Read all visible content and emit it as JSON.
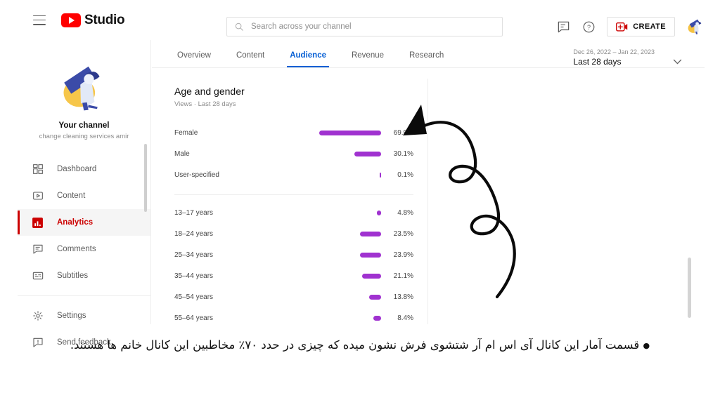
{
  "header": {
    "menu_icon": "hamburger-icon",
    "brand": "Studio",
    "logo_icon": "youtube-play-icon",
    "search": {
      "placeholder": "Search across your channel",
      "value": "",
      "icon": "search-icon"
    },
    "feedback_icon": "feedback-icon",
    "help_icon": "help-icon",
    "create_label": "CREATE",
    "create_icon": "create-video-icon",
    "avatar": "channel-avatar"
  },
  "sidebar": {
    "channel_label": "Your channel",
    "channel_name": "change cleaning services amir",
    "avatar_icon": "channel-avatar",
    "items": [
      {
        "label": "Dashboard",
        "icon": "dashboard-icon",
        "active": false
      },
      {
        "label": "Content",
        "icon": "content-video-icon",
        "active": false
      },
      {
        "label": "Analytics",
        "icon": "analytics-bar-icon",
        "active": true
      },
      {
        "label": "Comments",
        "icon": "comments-icon",
        "active": false
      },
      {
        "label": "Subtitles",
        "icon": "subtitles-icon",
        "active": false
      }
    ],
    "footer_items": [
      {
        "label": "Settings",
        "icon": "gear-icon"
      },
      {
        "label": "Send feedback",
        "icon": "send-feedback-icon"
      }
    ]
  },
  "analytics": {
    "tabs": [
      {
        "label": "Overview",
        "active": false
      },
      {
        "label": "Content",
        "active": false
      },
      {
        "label": "Audience",
        "active": true
      },
      {
        "label": "Revenue",
        "active": false
      },
      {
        "label": "Research",
        "active": false
      }
    ],
    "date_range": {
      "range": "Dec 26, 2022 – Jan 22, 2023",
      "preset": "Last 28 days",
      "caret_icon": "chevron-down-icon"
    }
  },
  "chart_data": {
    "type": "bar",
    "title": "Age and gender",
    "subtitle": "Views · Last 28 days",
    "orientation": "horizontal",
    "xlabel": "",
    "ylabel": "",
    "unit": "%",
    "grid": false,
    "legend": false,
    "bar_color": "#a032d0",
    "max_percent": 69.9,
    "groups": [
      {
        "name": "gender",
        "categories": [
          "Female",
          "Male",
          "User-specified"
        ],
        "values": [
          69.9,
          30.1,
          0.1
        ],
        "labels": [
          "69.9%",
          "30.1%",
          "0.1%"
        ]
      },
      {
        "name": "age",
        "categories": [
          "13–17 years",
          "18–24 years",
          "25–34 years",
          "35–44 years",
          "45–54 years",
          "55–64 years"
        ],
        "values": [
          4.8,
          23.5,
          23.9,
          21.1,
          13.8,
          8.4
        ],
        "labels": [
          "4.8%",
          "23.5%",
          "23.9%",
          "21.1%",
          "13.8%",
          "8.4%"
        ]
      }
    ]
  },
  "annotation": {
    "shape": "hand-drawn-curly-arrow",
    "color": "#000000",
    "points_to": "69.9%"
  },
  "caption": {
    "bullet": "●",
    "text": "قسمت آمار این کانال آی اس ام آر شتشوی فرش نشون میده که چیزی در حدد ۷۰٪ مخاطبین این کانال خانم ها هستند."
  },
  "scrollbars": {
    "sidebar": "sidebar-scrollbar",
    "main": "main-scrollbar"
  }
}
